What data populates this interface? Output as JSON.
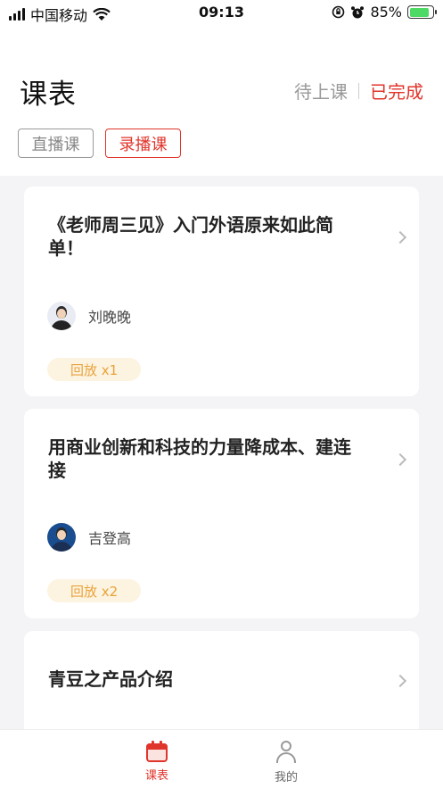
{
  "status_bar": {
    "carrier": "中国移动",
    "time": "09:13",
    "battery": "85%",
    "battery_level": 0.85,
    "icons": [
      "signal-icon",
      "wifi-icon",
      "orientation-lock-icon",
      "alarm-icon",
      "battery-icon"
    ]
  },
  "header": {
    "title": "课表",
    "status_tabs": [
      {
        "label": "待上课",
        "active": false
      },
      {
        "label": "已完成",
        "active": true
      }
    ],
    "type_tabs": [
      {
        "label": "直播课",
        "active": false
      },
      {
        "label": "录播课",
        "active": true
      }
    ]
  },
  "courses": [
    {
      "title": "《老师周三见》入门外语原来如此简单！",
      "teacher": "刘晚晚",
      "replay": "回放 x1"
    },
    {
      "title": "用商业创新和科技的力量降成本、建连接",
      "teacher": "吉登高",
      "replay": "回放 x2"
    },
    {
      "title": "青豆之产品介绍",
      "teacher": "",
      "replay": ""
    }
  ],
  "bottom_nav": {
    "items": [
      {
        "label": "课表",
        "icon": "calendar-icon",
        "active": true
      },
      {
        "label": "我的",
        "icon": "user-icon",
        "active": false
      }
    ]
  },
  "colors": {
    "accent": "#e0352b",
    "badge_bg": "#fdf3e1",
    "badge_text": "#e8a33a",
    "page_bg": "#f4f4f6"
  }
}
